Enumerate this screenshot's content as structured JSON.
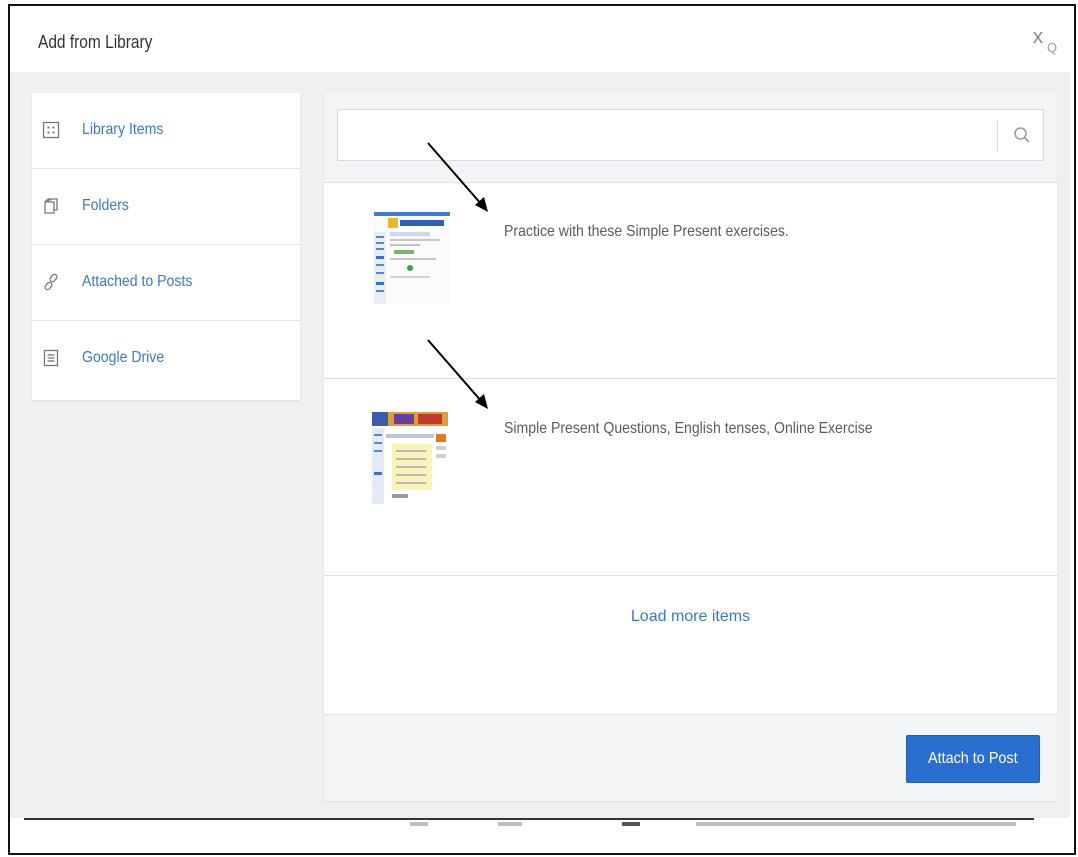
{
  "dialog": {
    "title": "Add from Library",
    "close_label": "x",
    "close_sub": "Q"
  },
  "sidebar": {
    "items": [
      {
        "label": "Library Items",
        "icon": "grid-icon"
      },
      {
        "label": "Folders",
        "icon": "folders-icon"
      },
      {
        "label": "Attached to Posts",
        "icon": "link-icon"
      },
      {
        "label": "Google Drive",
        "icon": "document-icon"
      }
    ]
  },
  "search": {
    "value": "",
    "placeholder": ""
  },
  "library_items": [
    {
      "title": "Practice with these Simple Present exercises."
    },
    {
      "title": "Simple Present Questions, English tenses, Online Exercise"
    }
  ],
  "load_more_label": "Load more items",
  "footer": {
    "attach_label": "Attach to Post"
  },
  "colors": {
    "link_blue": "#3b78c9",
    "button_blue": "#2a6fcf",
    "panel_gray": "#eef0f2"
  }
}
